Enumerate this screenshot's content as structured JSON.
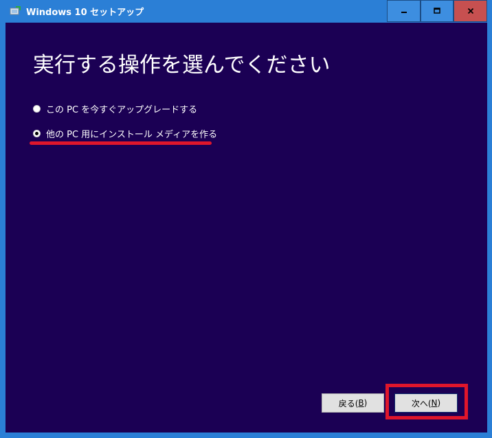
{
  "window": {
    "title": "Windows 10 セットアップ",
    "controls": {
      "minimize_icon": "minimize-icon",
      "maximize_icon": "maximize-icon",
      "close_icon": "close-icon"
    }
  },
  "main": {
    "heading": "実行する操作を選んでください",
    "options": [
      {
        "label": "この PC を今すぐアップグレードする",
        "selected": false
      },
      {
        "label": "他の PC 用にインストール メディアを作る",
        "selected": true
      }
    ],
    "annotation_color": "#e0162b"
  },
  "footer": {
    "back_label": "戻る(",
    "back_key": "B",
    "back_suffix": ")",
    "next_label": "次へ(",
    "next_key": "N",
    "next_suffix": ")"
  },
  "colors": {
    "titlebar": "#2b7fd6",
    "content_bg": "#1b0054",
    "close_button": "#c75050"
  }
}
